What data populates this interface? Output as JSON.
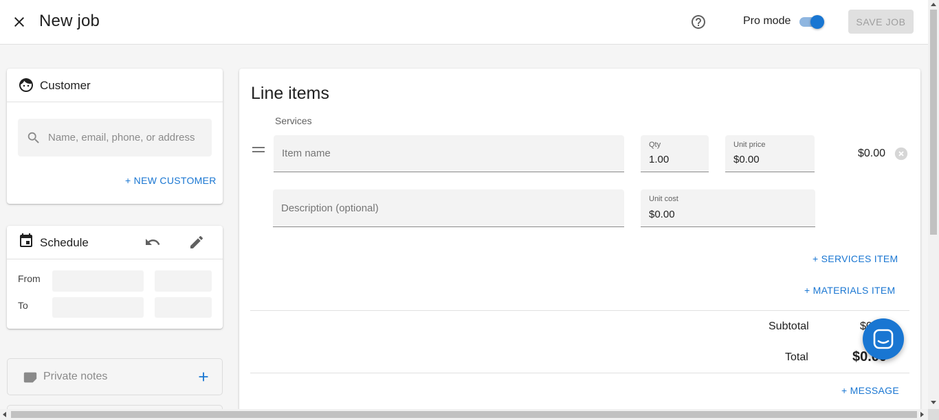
{
  "header": {
    "title": "New job",
    "pro_mode_label": "Pro mode",
    "pro_mode_on": true,
    "save_label": "SAVE JOB"
  },
  "customer": {
    "title": "Customer",
    "search_placeholder": "Name, email, phone, or address",
    "new_customer_label": "+ NEW CUSTOMER"
  },
  "schedule": {
    "title": "Schedule",
    "from_label": "From",
    "to_label": "To"
  },
  "notes": {
    "label": "Private notes"
  },
  "line_items": {
    "title": "Line items",
    "services_label": "Services",
    "item_name_placeholder": "Item name",
    "description_placeholder": "Description (optional)",
    "qty_label": "Qty",
    "qty_value": "1.00",
    "unit_price_label": "Unit price",
    "unit_price_value": "$0.00",
    "unit_cost_label": "Unit cost",
    "unit_cost_value": "$0.00",
    "line_total": "$0.00",
    "add_services_label": "+ SERVICES ITEM",
    "add_materials_label": "+ MATERIALS ITEM",
    "subtotal_label": "Subtotal",
    "subtotal_value": "$0.00",
    "total_label": "Total",
    "total_value": "$0.00",
    "add_message_label": "+ MESSAGE"
  },
  "colors": {
    "accent": "#1976d2",
    "field_bg": "#f3f3f3",
    "page_bg": "#f5f5f5"
  },
  "icons": [
    "close-icon",
    "help-icon",
    "face-icon",
    "search-icon",
    "calendar-icon",
    "undo-icon",
    "edit-icon",
    "note-icon",
    "add-icon",
    "drag-handle-icon",
    "remove-circle-icon",
    "chat-icon"
  ]
}
